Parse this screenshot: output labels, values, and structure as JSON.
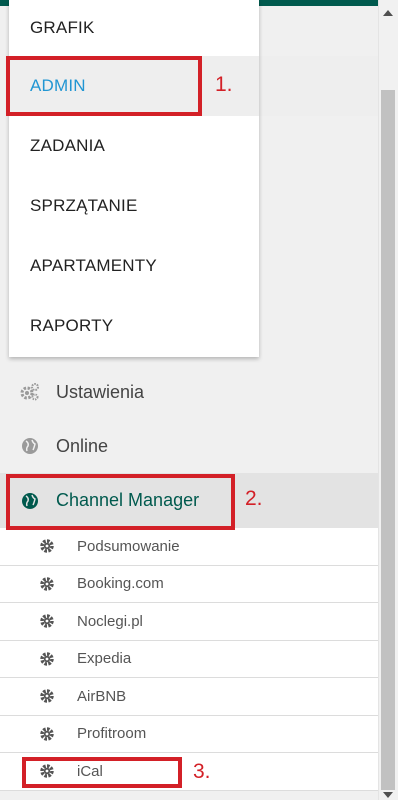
{
  "dropdown": {
    "items": [
      {
        "label": "GRAFIK"
      },
      {
        "label": "ADMIN"
      },
      {
        "label": "ZADANIA"
      },
      {
        "label": "SPRZĄTANIE"
      },
      {
        "label": "APARTAMENTY"
      },
      {
        "label": "RAPORTY"
      }
    ]
  },
  "sidebar": {
    "items": [
      {
        "label": "Ustawienia",
        "icon": "gears-icon"
      },
      {
        "label": "Online",
        "icon": "globe-icon"
      },
      {
        "label": "Channel Manager",
        "icon": "globe-icon"
      }
    ],
    "subitems": [
      {
        "label": "Podsumowanie",
        "icon": "gear-icon"
      },
      {
        "label": "Booking.com",
        "icon": "gear-icon"
      },
      {
        "label": "Noclegi.pl",
        "icon": "gear-icon"
      },
      {
        "label": "Expedia",
        "icon": "gear-icon"
      },
      {
        "label": "AirBNB",
        "icon": "gear-icon"
      },
      {
        "label": "Profitroom",
        "icon": "gear-icon"
      },
      {
        "label": "iCal",
        "icon": "gear-icon"
      }
    ]
  },
  "annotations": {
    "step1": "1.",
    "step2": "2.",
    "step3": "3."
  },
  "colors": {
    "accent_blue": "#2196d3",
    "accent_green": "#005a4e",
    "annotation_red": "#d32027"
  }
}
